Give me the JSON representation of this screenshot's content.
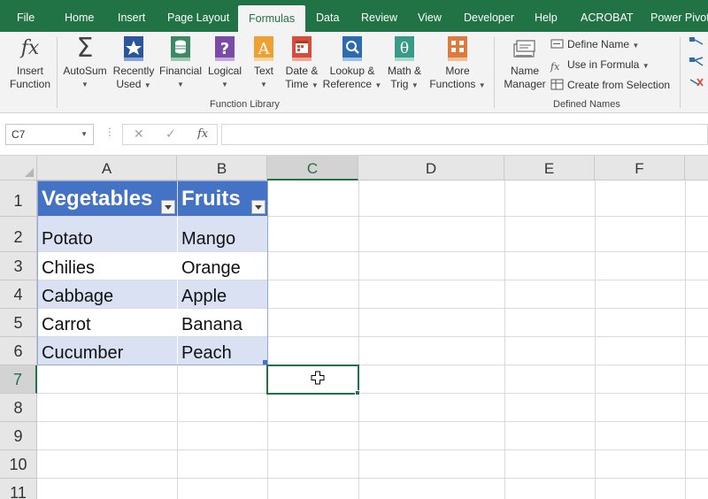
{
  "tabs": [
    "File",
    "Home",
    "Insert",
    "Page Layout",
    "Formulas",
    "Data",
    "Review",
    "View",
    "Developer",
    "Help",
    "ACROBAT",
    "Power Pivot"
  ],
  "active_tab": "Formulas",
  "ribbon": {
    "insert_function": [
      "Insert",
      "Function"
    ],
    "autosum": "AutoSum",
    "recently_used": [
      "Recently",
      "Used"
    ],
    "financial": "Financial",
    "logical": "Logical",
    "text": "Text",
    "date_time": [
      "Date &",
      "Time"
    ],
    "lookup_reference": [
      "Lookup &",
      "Reference"
    ],
    "math_trig": [
      "Math &",
      "Trig"
    ],
    "more_functions": [
      "More",
      "Functions"
    ],
    "function_library_label": "Function Library",
    "name_manager": [
      "Name",
      "Manager"
    ],
    "define_name": "Define Name",
    "use_in_formula": "Use in Formula",
    "create_from_selection": "Create from Selection",
    "defined_names_label": "Defined Names",
    "icon_glyphs": {
      "fx": "fx",
      "sigma": "Σ",
      "question": "?",
      "text_a": "A",
      "theta": "θ"
    }
  },
  "formula_bar": {
    "name_box": "C7",
    "cancel_glyph": "✕",
    "enter_glyph": "✓",
    "fx_glyph": "fx",
    "formula": ""
  },
  "grid": {
    "columns": [
      "A",
      "B",
      "C",
      "D",
      "E",
      "F"
    ],
    "rows": [
      "1",
      "2",
      "3",
      "4",
      "5",
      "6",
      "7",
      "8",
      "9",
      "10",
      "11"
    ],
    "selected_column": "C",
    "selected_row": "7",
    "table_headers": [
      "Vegetables",
      "Fruits"
    ],
    "table_rows": [
      [
        "Potato",
        "Mango"
      ],
      [
        "Chilies",
        "Orange"
      ],
      [
        "Cabbage",
        "Apple"
      ],
      [
        "Carrot",
        "Banana"
      ],
      [
        "Cucumber",
        "Peach"
      ]
    ]
  },
  "colors": {
    "excel_green": "#217346",
    "table_header_blue": "#4472c4",
    "table_band_blue": "#d9e1f2"
  }
}
